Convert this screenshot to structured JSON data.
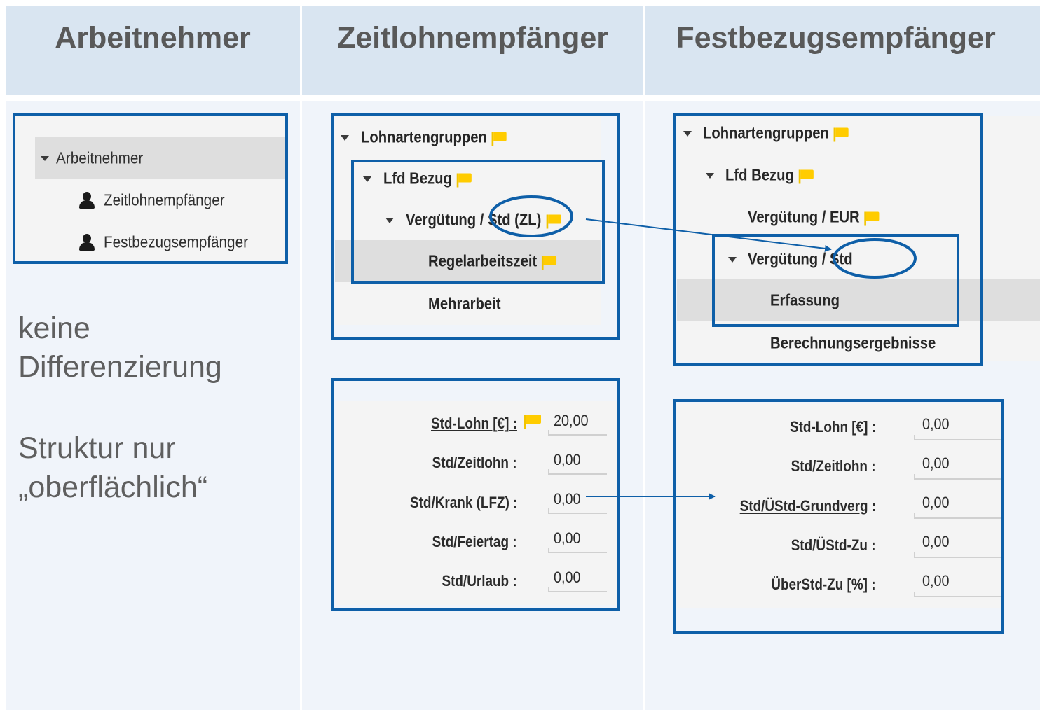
{
  "headers": {
    "col1": "Arbeitnehmer",
    "col2": "Zeitlohnempfänger",
    "col3": "Festbezugsempfänger"
  },
  "col1_tree": {
    "root": "Arbeitnehmer",
    "items": [
      "Zeitlohnempfänger",
      "Festbezugsempfänger"
    ]
  },
  "col1_notes": {
    "line1": "keine",
    "line2": "Differenzierung",
    "line3": "Struktur nur",
    "line4": "„oberflächlich“"
  },
  "col2_tree": {
    "group": "Lohnartengruppen",
    "lfd": "Lfd Bezug",
    "verguetung_prefix": "Vergütung",
    "verguetung_suffix": "/ Std (ZL)",
    "regel": "Regelarbeitszeit",
    "mehr": "Mehrarbeit"
  },
  "col3_tree": {
    "group": "Lohnartengruppen",
    "lfd": "Lfd Bezug",
    "verg_eur": "Vergütung / EUR",
    "verguetung_prefix": "Vergütung",
    "verguetung_suffix": "/ Std",
    "erfassung": "Erfassung",
    "berechnung": "Berechnungsergebnisse"
  },
  "col2_fields": [
    {
      "label": "Std-Lohn  [€] :",
      "value": "20,00"
    },
    {
      "label": "Std/Zeitlohn :",
      "value": "0,00"
    },
    {
      "label": "Std/Krank (LFZ) :",
      "value": "0,00"
    },
    {
      "label": "Std/Feiertag :",
      "value": "0,00"
    },
    {
      "label": "Std/Urlaub :",
      "value": "0,00"
    }
  ],
  "col3_fields": [
    {
      "label": "Std-Lohn  [€] :",
      "value": "0,00"
    },
    {
      "label": "Std/Zeitlohn :",
      "value": "0,00"
    },
    {
      "label": "Std/ÜStd-Grundverg",
      "suffix": " :",
      "value": "0,00"
    },
    {
      "label": "Std/ÜStd-Zu :",
      "value": "0,00"
    },
    {
      "label": "ÜberStd-Zu [%] :",
      "value": "0,00"
    }
  ],
  "colors": {
    "header_bg": "#d9e5f1",
    "column_bg": "#f0f4fa",
    "accent_blue": "#0e5fa8",
    "flag_yellow": "#ffcc00"
  },
  "icons": [
    "chevron-down-icon",
    "person-icon",
    "flag-icon",
    "arrow-icon"
  ]
}
